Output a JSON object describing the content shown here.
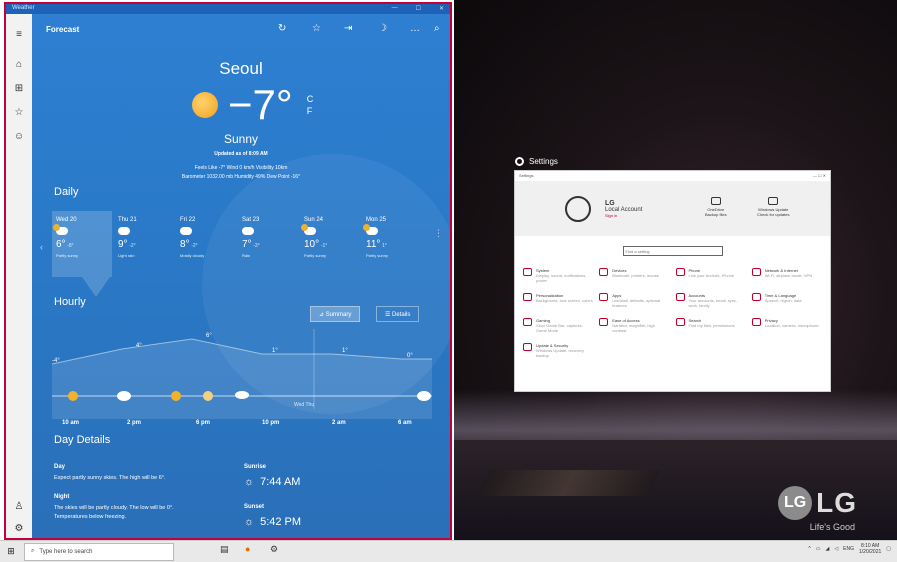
{
  "weather": {
    "window_title": "Weather",
    "window_buttons": [
      "—",
      "☐",
      "✕"
    ],
    "toolbar": {
      "title": "Forecast"
    },
    "city": "Seoul",
    "temperature": "−7°",
    "units": {
      "c": "C",
      "f": "F"
    },
    "condition": "Sunny",
    "updated": "Updated as of 8:09 AM",
    "stats_line1": "Feels Like  -7°    Wind  0 km/h    Visibility  10km",
    "stats_line2": "Barometer  1032.00 mb    Humidity  49%    Dew Point  -16°",
    "daily_title": "Daily",
    "days": [
      {
        "name": "Wed 20",
        "high": "6°",
        "low": "-8°",
        "desc": "Partly sunny"
      },
      {
        "name": "Thu 21",
        "high": "9°",
        "low": "-2°",
        "desc": "Light rain"
      },
      {
        "name": "Fri 22",
        "high": "8°",
        "low": "-2°",
        "desc": "Mostly cloudy"
      },
      {
        "name": "Sat 23",
        "high": "7°",
        "low": "-3°",
        "desc": "Rain"
      },
      {
        "name": "Sun 24",
        "high": "10°",
        "low": "-1°",
        "desc": "Partly sunny"
      },
      {
        "name": "Mon 25",
        "high": "11°",
        "low": "1°",
        "desc": "Partly sunny"
      }
    ],
    "hourly_title": "Hourly",
    "toggle_summary": "Summary",
    "toggle_details": "Details",
    "hourly_temps": [
      "-4°",
      "4°",
      "6°",
      "1°",
      "1°",
      "0°"
    ],
    "hourly_marker": "Wed  Thu",
    "hours": [
      "10 am",
      "2 pm",
      "6 pm",
      "10 pm",
      "2 am",
      "6 am"
    ],
    "day_details_title": "Day Details",
    "day_label": "Day",
    "day_text": "Expect partly sunny skies. The high will be 6°.",
    "night_label": "Night",
    "night_text_1": "The skies will be partly cloudy. The low will be 0°.",
    "night_text_2": "Temperatures below freezing.",
    "sunrise_label": "Sunrise",
    "sunrise_time": "7:44 AM",
    "sunset_label": "Sunset",
    "sunset_time": "5:42 PM"
  },
  "settings": {
    "caption": "Settings",
    "window_title": "Settings",
    "account_name": "LG",
    "account_sub": "Local Account",
    "account_link": "Sign in",
    "onedrive": "OneDrive",
    "onedrive_sub": "Backup files",
    "windows_update": "Windows Update",
    "windows_update_sub": "Check for updates",
    "search_placeholder": "Find a setting",
    "items": [
      {
        "title": "System",
        "sub": "Display, sound, notifications, power"
      },
      {
        "title": "Devices",
        "sub": "Bluetooth, printers, mouse"
      },
      {
        "title": "Phone",
        "sub": "Link your Android, iPhone"
      },
      {
        "title": "Network & Internet",
        "sub": "Wi-Fi, airplane mode, VPN"
      },
      {
        "title": "Personalization",
        "sub": "Background, lock screen, colors"
      },
      {
        "title": "Apps",
        "sub": "Uninstall, defaults, optional features"
      },
      {
        "title": "Accounts",
        "sub": "Your accounts, email, sync, work, family"
      },
      {
        "title": "Time & Language",
        "sub": "Speech, region, date"
      },
      {
        "title": "Gaming",
        "sub": "Xbox Game Bar, captures, Game Mode"
      },
      {
        "title": "Ease of Access",
        "sub": "Narrator, magnifier, high contrast"
      },
      {
        "title": "Search",
        "sub": "Find my files, permissions"
      },
      {
        "title": "Privacy",
        "sub": "Location, camera, microphone"
      },
      {
        "title": "Update & Security",
        "sub": "Windows Update, recovery, backup"
      }
    ]
  },
  "desktop": {
    "brand_text": "LG",
    "brand_tagline": "Life's Good"
  },
  "taskbar": {
    "search_placeholder": "Type here to search",
    "tray_lang": "ENG",
    "time": "8:10 AM",
    "date": "1/20/2021"
  }
}
